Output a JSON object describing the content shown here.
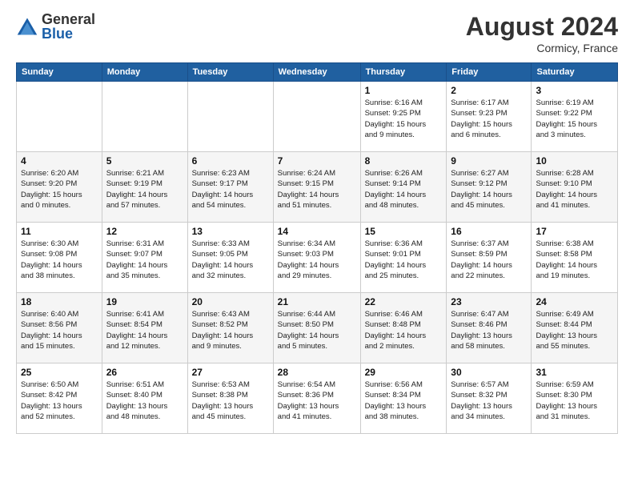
{
  "header": {
    "logo": {
      "general": "General",
      "blue": "Blue"
    },
    "title": "August 2024",
    "location": "Cormicy, France"
  },
  "calendar": {
    "days_of_week": [
      "Sunday",
      "Monday",
      "Tuesday",
      "Wednesday",
      "Thursday",
      "Friday",
      "Saturday"
    ],
    "weeks": [
      [
        {
          "day": "",
          "info": ""
        },
        {
          "day": "",
          "info": ""
        },
        {
          "day": "",
          "info": ""
        },
        {
          "day": "",
          "info": ""
        },
        {
          "day": "1",
          "info": "Sunrise: 6:16 AM\nSunset: 9:25 PM\nDaylight: 15 hours\nand 9 minutes."
        },
        {
          "day": "2",
          "info": "Sunrise: 6:17 AM\nSunset: 9:23 PM\nDaylight: 15 hours\nand 6 minutes."
        },
        {
          "day": "3",
          "info": "Sunrise: 6:19 AM\nSunset: 9:22 PM\nDaylight: 15 hours\nand 3 minutes."
        }
      ],
      [
        {
          "day": "4",
          "info": "Sunrise: 6:20 AM\nSunset: 9:20 PM\nDaylight: 15 hours\nand 0 minutes."
        },
        {
          "day": "5",
          "info": "Sunrise: 6:21 AM\nSunset: 9:19 PM\nDaylight: 14 hours\nand 57 minutes."
        },
        {
          "day": "6",
          "info": "Sunrise: 6:23 AM\nSunset: 9:17 PM\nDaylight: 14 hours\nand 54 minutes."
        },
        {
          "day": "7",
          "info": "Sunrise: 6:24 AM\nSunset: 9:15 PM\nDaylight: 14 hours\nand 51 minutes."
        },
        {
          "day": "8",
          "info": "Sunrise: 6:26 AM\nSunset: 9:14 PM\nDaylight: 14 hours\nand 48 minutes."
        },
        {
          "day": "9",
          "info": "Sunrise: 6:27 AM\nSunset: 9:12 PM\nDaylight: 14 hours\nand 45 minutes."
        },
        {
          "day": "10",
          "info": "Sunrise: 6:28 AM\nSunset: 9:10 PM\nDaylight: 14 hours\nand 41 minutes."
        }
      ],
      [
        {
          "day": "11",
          "info": "Sunrise: 6:30 AM\nSunset: 9:08 PM\nDaylight: 14 hours\nand 38 minutes."
        },
        {
          "day": "12",
          "info": "Sunrise: 6:31 AM\nSunset: 9:07 PM\nDaylight: 14 hours\nand 35 minutes."
        },
        {
          "day": "13",
          "info": "Sunrise: 6:33 AM\nSunset: 9:05 PM\nDaylight: 14 hours\nand 32 minutes."
        },
        {
          "day": "14",
          "info": "Sunrise: 6:34 AM\nSunset: 9:03 PM\nDaylight: 14 hours\nand 29 minutes."
        },
        {
          "day": "15",
          "info": "Sunrise: 6:36 AM\nSunset: 9:01 PM\nDaylight: 14 hours\nand 25 minutes."
        },
        {
          "day": "16",
          "info": "Sunrise: 6:37 AM\nSunset: 8:59 PM\nDaylight: 14 hours\nand 22 minutes."
        },
        {
          "day": "17",
          "info": "Sunrise: 6:38 AM\nSunset: 8:58 PM\nDaylight: 14 hours\nand 19 minutes."
        }
      ],
      [
        {
          "day": "18",
          "info": "Sunrise: 6:40 AM\nSunset: 8:56 PM\nDaylight: 14 hours\nand 15 minutes."
        },
        {
          "day": "19",
          "info": "Sunrise: 6:41 AM\nSunset: 8:54 PM\nDaylight: 14 hours\nand 12 minutes."
        },
        {
          "day": "20",
          "info": "Sunrise: 6:43 AM\nSunset: 8:52 PM\nDaylight: 14 hours\nand 9 minutes."
        },
        {
          "day": "21",
          "info": "Sunrise: 6:44 AM\nSunset: 8:50 PM\nDaylight: 14 hours\nand 5 minutes."
        },
        {
          "day": "22",
          "info": "Sunrise: 6:46 AM\nSunset: 8:48 PM\nDaylight: 14 hours\nand 2 minutes."
        },
        {
          "day": "23",
          "info": "Sunrise: 6:47 AM\nSunset: 8:46 PM\nDaylight: 13 hours\nand 58 minutes."
        },
        {
          "day": "24",
          "info": "Sunrise: 6:49 AM\nSunset: 8:44 PM\nDaylight: 13 hours\nand 55 minutes."
        }
      ],
      [
        {
          "day": "25",
          "info": "Sunrise: 6:50 AM\nSunset: 8:42 PM\nDaylight: 13 hours\nand 52 minutes."
        },
        {
          "day": "26",
          "info": "Sunrise: 6:51 AM\nSunset: 8:40 PM\nDaylight: 13 hours\nand 48 minutes."
        },
        {
          "day": "27",
          "info": "Sunrise: 6:53 AM\nSunset: 8:38 PM\nDaylight: 13 hours\nand 45 minutes."
        },
        {
          "day": "28",
          "info": "Sunrise: 6:54 AM\nSunset: 8:36 PM\nDaylight: 13 hours\nand 41 minutes."
        },
        {
          "day": "29",
          "info": "Sunrise: 6:56 AM\nSunset: 8:34 PM\nDaylight: 13 hours\nand 38 minutes."
        },
        {
          "day": "30",
          "info": "Sunrise: 6:57 AM\nSunset: 8:32 PM\nDaylight: 13 hours\nand 34 minutes."
        },
        {
          "day": "31",
          "info": "Sunrise: 6:59 AM\nSunset: 8:30 PM\nDaylight: 13 hours\nand 31 minutes."
        }
      ]
    ]
  }
}
